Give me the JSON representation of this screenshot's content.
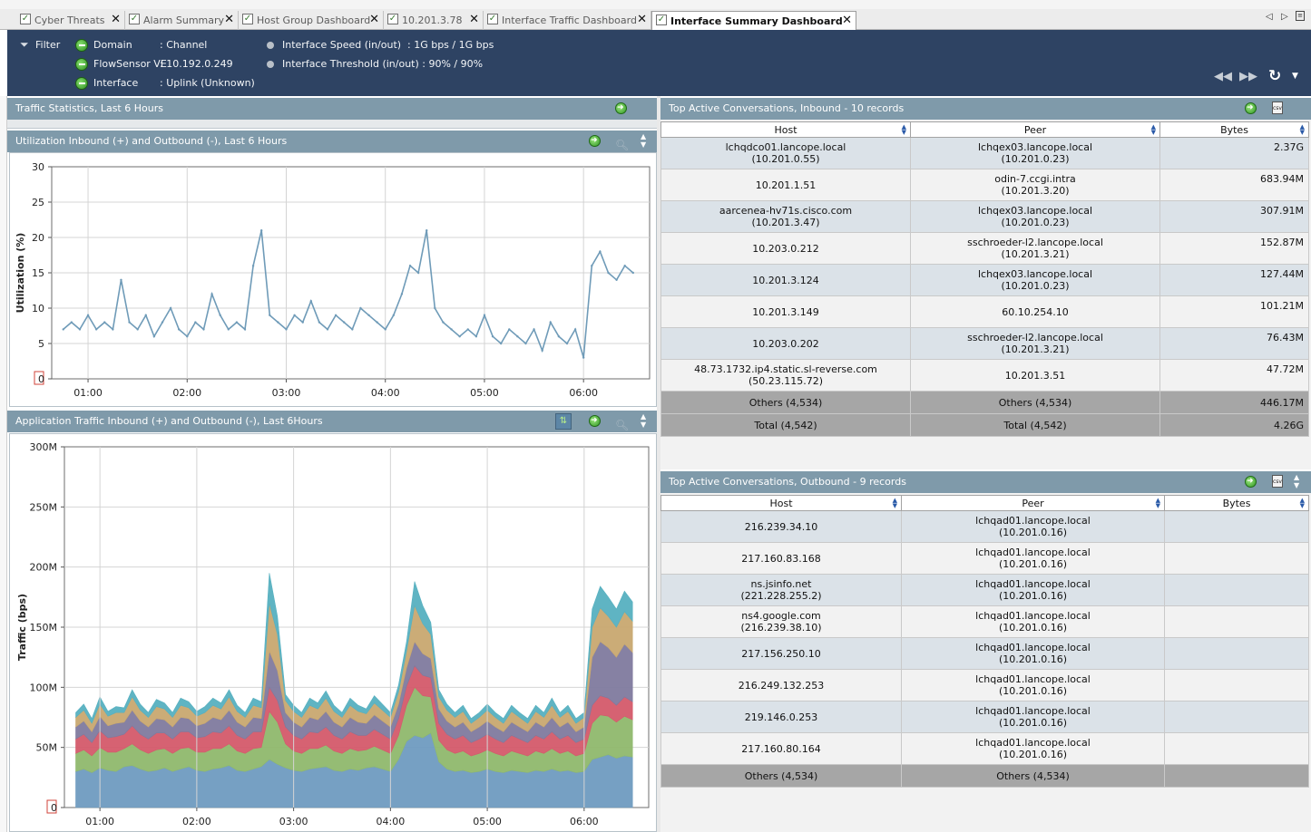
{
  "tabs": [
    {
      "label": "Cyber Threats",
      "active": false
    },
    {
      "label": "Alarm Summary",
      "active": false
    },
    {
      "label": "Host Group Dashboard",
      "active": false
    },
    {
      "label": "10.201.3.78",
      "active": false
    },
    {
      "label": "Interface Traffic Dashboard",
      "active": false
    },
    {
      "label": "Interface Summary Dashboard",
      "active": true
    }
  ],
  "filter": {
    "label": "Filter",
    "domain_key": "Domain",
    "domain_val": ": Channel",
    "flowsensor_key": "FlowSensor VE",
    "flowsensor_val": ": 10.192.0.249",
    "interface_key": "Interface",
    "interface_val": ": Uplink (Unknown)",
    "speed_key": "Interface Speed (in/out)",
    "speed_val": ": 1G bps / 1G bps",
    "threshold_text": "Interface Threshold (in/out) : 90% / 90%"
  },
  "panels": {
    "traffic_stats": "Traffic Statistics, Last 6 Hours",
    "utilization": "Utilization Inbound (+) and Outbound (-), Last 6 Hours",
    "app_traffic": "Application Traffic Inbound (+) and Outbound (-), Last 6Hours",
    "inbound": "Top Active Conversations, Inbound - 10 records",
    "outbound": "Top Active Conversations, Outbound - 9 records"
  },
  "chart_data": [
    {
      "type": "line",
      "ylabel": "Utilization (%)",
      "ylim": [
        0,
        30
      ],
      "yticks": [
        "0",
        "5",
        "10",
        "15",
        "20",
        "25",
        "30"
      ],
      "xticks": [
        "01:00",
        "02:00",
        "03:00",
        "04:00",
        "05:00",
        "06:00"
      ],
      "color": "#6f9bb8",
      "series": [
        {
          "x": [
            "00:45",
            "00:50",
            "00:55",
            "01:00",
            "01:05",
            "01:10",
            "01:15",
            "01:20",
            "01:25",
            "01:30",
            "01:35",
            "01:40",
            "01:45",
            "01:50",
            "01:55",
            "02:00",
            "02:05",
            "02:10",
            "02:15",
            "02:20",
            "02:25",
            "02:30",
            "02:35",
            "02:40",
            "02:45",
            "02:50",
            "02:55",
            "03:00",
            "03:05",
            "03:10",
            "03:15",
            "03:20",
            "03:25",
            "03:30",
            "03:35",
            "03:40",
            "03:45",
            "03:50",
            "03:55",
            "04:00",
            "04:05",
            "04:10",
            "04:15",
            "04:20",
            "04:25",
            "04:30",
            "04:35",
            "04:40",
            "04:45",
            "04:50",
            "04:55",
            "05:00",
            "05:05",
            "05:10",
            "05:15",
            "05:20",
            "05:25",
            "05:30",
            "05:35",
            "05:40",
            "05:45",
            "05:50",
            "05:55",
            "06:00",
            "06:05",
            "06:10",
            "06:15",
            "06:20",
            "06:25",
            "06:30"
          ],
          "values": [
            7,
            8,
            7,
            9,
            7,
            8,
            7,
            14,
            8,
            7,
            9,
            6,
            8,
            10,
            7,
            6,
            8,
            7,
            12,
            9,
            7,
            8,
            7,
            16,
            21,
            9,
            8,
            7,
            9,
            8,
            11,
            8,
            7,
            9,
            8,
            7,
            10,
            9,
            8,
            7,
            9,
            12,
            16,
            15,
            21,
            10,
            8,
            7,
            6,
            7,
            6,
            9,
            6,
            5,
            7,
            6,
            5,
            7,
            4,
            8,
            6,
            5,
            7,
            3,
            16,
            18,
            15,
            14,
            16,
            15
          ]
        }
      ]
    },
    {
      "type": "area",
      "stacked": true,
      "ylabel": "Traffic (bps)",
      "ylim": [
        0,
        300
      ],
      "yticks": [
        "0",
        "50M",
        "100M",
        "150M",
        "200M",
        "250M",
        "300M"
      ],
      "xticks": [
        "01:00",
        "02:00",
        "03:00",
        "04:00",
        "05:00",
        "06:00"
      ],
      "x": [
        "00:45",
        "00:50",
        "00:55",
        "01:00",
        "01:05",
        "01:10",
        "01:15",
        "01:20",
        "01:25",
        "01:30",
        "01:35",
        "01:40",
        "01:45",
        "01:50",
        "01:55",
        "02:00",
        "02:05",
        "02:10",
        "02:15",
        "02:20",
        "02:25",
        "02:30",
        "02:35",
        "02:40",
        "02:45",
        "02:50",
        "02:55",
        "03:00",
        "03:05",
        "03:10",
        "03:15",
        "03:20",
        "03:25",
        "03:30",
        "03:35",
        "03:40",
        "03:45",
        "03:50",
        "03:55",
        "04:00",
        "04:05",
        "04:10",
        "04:15",
        "04:20",
        "04:25",
        "04:30",
        "04:35",
        "04:40",
        "04:45",
        "04:50",
        "04:55",
        "05:00",
        "05:05",
        "05:10",
        "05:15",
        "05:20",
        "05:25",
        "05:30",
        "05:35",
        "05:40",
        "05:45",
        "05:50",
        "05:55",
        "06:00",
        "06:05",
        "06:10",
        "06:15",
        "06:20",
        "06:25",
        "06:30"
      ],
      "series": [
        {
          "color": "#6f9bc0",
          "values": [
            30,
            32,
            29,
            33,
            31,
            30,
            34,
            35,
            32,
            30,
            31,
            33,
            30,
            32,
            34,
            31,
            30,
            32,
            33,
            35,
            31,
            30,
            32,
            34,
            40,
            36,
            33,
            31,
            30,
            32,
            33,
            34,
            31,
            30,
            32,
            31,
            33,
            34,
            32,
            30,
            40,
            55,
            60,
            58,
            62,
            38,
            32,
            30,
            31,
            29,
            30,
            32,
            30,
            29,
            31,
            30,
            29,
            31,
            30,
            32,
            30,
            31,
            29,
            30,
            40,
            42,
            44,
            41,
            43,
            42
          ]
        },
        {
          "color": "#8fb86d",
          "values": [
            15,
            16,
            14,
            17,
            15,
            16,
            15,
            18,
            16,
            15,
            17,
            16,
            15,
            17,
            16,
            15,
            16,
            17,
            16,
            18,
            16,
            15,
            17,
            16,
            40,
            35,
            20,
            16,
            15,
            17,
            16,
            18,
            16,
            15,
            17,
            16,
            15,
            17,
            16,
            15,
            20,
            30,
            40,
            35,
            30,
            18,
            16,
            15,
            16,
            14,
            15,
            16,
            15,
            14,
            16,
            15,
            14,
            16,
            15,
            17,
            15,
            16,
            14,
            15,
            30,
            35,
            32,
            30,
            33,
            31
          ]
        },
        {
          "color": "#d45a6a",
          "values": [
            12,
            13,
            11,
            14,
            12,
            13,
            12,
            15,
            13,
            12,
            14,
            13,
            12,
            14,
            13,
            12,
            13,
            14,
            13,
            15,
            13,
            12,
            14,
            13,
            20,
            18,
            14,
            13,
            12,
            14,
            13,
            15,
            13,
            12,
            14,
            13,
            12,
            14,
            13,
            12,
            14,
            16,
            18,
            17,
            16,
            14,
            13,
            12,
            13,
            11,
            12,
            13,
            12,
            11,
            13,
            12,
            11,
            13,
            12,
            14,
            12,
            13,
            11,
            12,
            15,
            16,
            15,
            14,
            16,
            15
          ]
        },
        {
          "color": "#7f7a9e",
          "values": [
            10,
            11,
            9,
            12,
            10,
            11,
            10,
            13,
            11,
            10,
            12,
            11,
            10,
            12,
            11,
            10,
            11,
            12,
            11,
            13,
            11,
            10,
            12,
            11,
            30,
            25,
            12,
            11,
            10,
            12,
            11,
            13,
            11,
            10,
            12,
            11,
            10,
            12,
            11,
            10,
            12,
            15,
            20,
            18,
            16,
            12,
            11,
            10,
            11,
            9,
            10,
            11,
            10,
            9,
            11,
            10,
            9,
            11,
            10,
            12,
            10,
            11,
            9,
            10,
            40,
            45,
            42,
            40,
            44,
            41
          ]
        },
        {
          "color": "#c8a870",
          "values": [
            8,
            9,
            7,
            10,
            8,
            9,
            8,
            11,
            9,
            8,
            10,
            9,
            8,
            10,
            9,
            8,
            9,
            10,
            9,
            11,
            9,
            8,
            10,
            9,
            40,
            30,
            10,
            9,
            8,
            10,
            9,
            11,
            9,
            8,
            10,
            9,
            8,
            10,
            9,
            8,
            10,
            14,
            30,
            25,
            20,
            10,
            9,
            8,
            9,
            7,
            8,
            9,
            8,
            7,
            9,
            8,
            7,
            9,
            8,
            10,
            8,
            9,
            7,
            8,
            25,
            28,
            26,
            25,
            27,
            26
          ]
        },
        {
          "color": "#56b0c0",
          "values": [
            4,
            5,
            4,
            6,
            4,
            5,
            4,
            6,
            5,
            4,
            6,
            5,
            4,
            6,
            5,
            4,
            5,
            6,
            5,
            6,
            5,
            4,
            6,
            5,
            25,
            15,
            5,
            5,
            4,
            6,
            5,
            6,
            5,
            4,
            6,
            5,
            4,
            6,
            5,
            4,
            6,
            8,
            20,
            15,
            10,
            6,
            5,
            4,
            5,
            4,
            4,
            5,
            4,
            4,
            5,
            4,
            4,
            5,
            4,
            6,
            4,
            5,
            4,
            4,
            15,
            18,
            16,
            15,
            17,
            16
          ]
        }
      ]
    }
  ],
  "inbound_table": {
    "headers": [
      "Host",
      "Peer",
      "Bytes"
    ],
    "rows": [
      {
        "host1": "lchqdco01.lancope.local",
        "host2": "(10.201.0.55)",
        "peer1": "lchqex03.lancope.local",
        "peer2": "(10.201.0.23)",
        "bytes": "2.37G"
      },
      {
        "host1": "10.201.1.51",
        "host2": "",
        "peer1": "odin-7.ccgi.intra",
        "peer2": "(10.201.3.20)",
        "bytes": "683.94M"
      },
      {
        "host1": "aarcenea-hv71s.cisco.com",
        "host2": "(10.201.3.47)",
        "peer1": "lchqex03.lancope.local",
        "peer2": "(10.201.0.23)",
        "bytes": "307.91M"
      },
      {
        "host1": "10.203.0.212",
        "host2": "",
        "peer1": "sschroeder-l2.lancope.local",
        "peer2": "(10.201.3.21)",
        "bytes": "152.87M"
      },
      {
        "host1": "10.201.3.124",
        "host2": "",
        "peer1": "lchqex03.lancope.local",
        "peer2": "(10.201.0.23)",
        "bytes": "127.44M"
      },
      {
        "host1": "10.201.3.149",
        "host2": "",
        "peer1": "60.10.254.10",
        "peer2": "",
        "bytes": "101.21M"
      },
      {
        "host1": "10.203.0.202",
        "host2": "",
        "peer1": "sschroeder-l2.lancope.local",
        "peer2": "(10.201.3.21)",
        "bytes": "76.43M"
      },
      {
        "host1": "48.73.1732.ip4.static.sl-reverse.com",
        "host2": "(50.23.115.72)",
        "peer1": "10.201.3.51",
        "peer2": "",
        "bytes": "47.72M"
      }
    ],
    "others": {
      "host": "Others (4,534)",
      "peer": "Others (4,534)",
      "bytes": "446.17M"
    },
    "total": {
      "host": "Total (4,542)",
      "peer": "Total (4,542)",
      "bytes": "4.26G"
    }
  },
  "outbound_table": {
    "headers": [
      "Host",
      "Peer",
      "Bytes"
    ],
    "rows": [
      {
        "host1": "216.239.34.10",
        "host2": "",
        "peer1": "lchqad01.lancope.local",
        "peer2": "(10.201.0.16)",
        "bytes": ""
      },
      {
        "host1": "217.160.83.168",
        "host2": "",
        "peer1": "lchqad01.lancope.local",
        "peer2": "(10.201.0.16)",
        "bytes": ""
      },
      {
        "host1": "ns.jsinfo.net",
        "host2": "(221.228.255.2)",
        "peer1": "lchqad01.lancope.local",
        "peer2": "(10.201.0.16)",
        "bytes": ""
      },
      {
        "host1": "ns4.google.com",
        "host2": "(216.239.38.10)",
        "peer1": "lchqad01.lancope.local",
        "peer2": "(10.201.0.16)",
        "bytes": ""
      },
      {
        "host1": "217.156.250.10",
        "host2": "",
        "peer1": "lchqad01.lancope.local",
        "peer2": "(10.201.0.16)",
        "bytes": ""
      },
      {
        "host1": "216.249.132.253",
        "host2": "",
        "peer1": "lchqad01.lancope.local",
        "peer2": "(10.201.0.16)",
        "bytes": ""
      },
      {
        "host1": "219.146.0.253",
        "host2": "",
        "peer1": "lchqad01.lancope.local",
        "peer2": "(10.201.0.16)",
        "bytes": ""
      },
      {
        "host1": "217.160.80.164",
        "host2": "",
        "peer1": "lchqad01.lancope.local",
        "peer2": "(10.201.0.16)",
        "bytes": ""
      }
    ],
    "others": {
      "host": "Others (4,534)",
      "peer": "Others (4,534)",
      "bytes": ""
    }
  }
}
